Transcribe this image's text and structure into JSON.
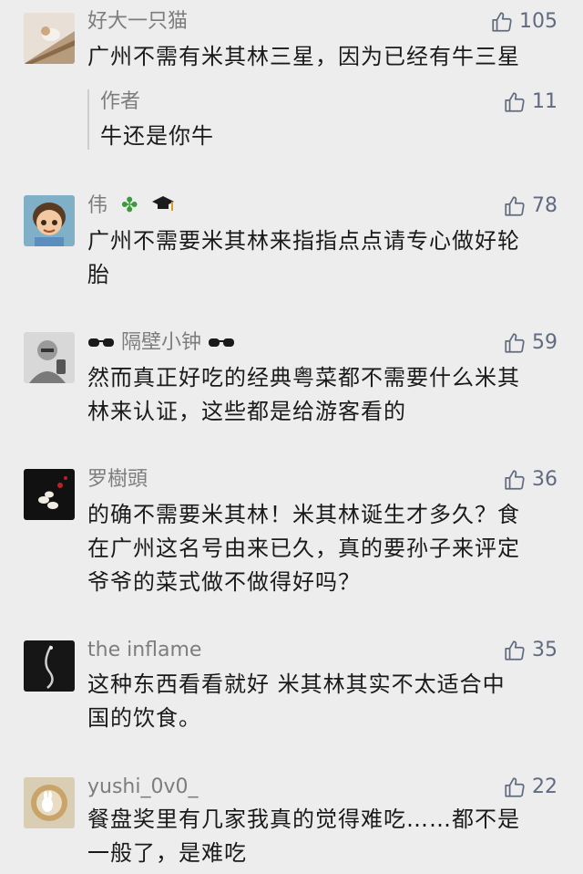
{
  "colors": {
    "background": "#ededed",
    "name": "#7d7d7d",
    "like_icon": "#616b80",
    "text": "#1a1a1a"
  },
  "comments": [
    {
      "name": "好大一只猫",
      "likes": "105",
      "lines": [
        "广州不需有米其林三星，因为已经有牛三星"
      ],
      "reply": {
        "name": "作者",
        "likes": "11",
        "lines": [
          "牛还是你牛"
        ]
      }
    },
    {
      "name": "伟",
      "name_icons": [
        "clover-icon",
        "graduation-cap-icon"
      ],
      "likes": "78",
      "lines": [
        "广州不需要米其林来指指点点请专心做好轮",
        "胎"
      ]
    },
    {
      "name": "隔壁小钟",
      "name_icons": [
        "sunglasses-icon",
        "sunglasses-icon"
      ],
      "likes": "59",
      "lines": [
        "然而真正好吃的经典粤菜都不需要什么米其",
        "林来认证，这些都是给游客看的"
      ]
    },
    {
      "name": "罗樹頭",
      "likes": "36",
      "lines": [
        "的确不需要米其林！米其林诞生才多久？食",
        "在广州这名号由来已久，真的要孙子来评定",
        "爷爷的菜式做不做得好吗？"
      ]
    },
    {
      "name": "the inflame",
      "likes": "35",
      "lines": [
        "这种东西看看就好 米其林其实不太适合中",
        "国的饮食。"
      ]
    },
    {
      "name": "yushi_0v0_",
      "likes": "22",
      "lines": [
        "餐盘奖里有几家我真的觉得难吃……都不是",
        "一般了，是难吃"
      ]
    }
  ]
}
